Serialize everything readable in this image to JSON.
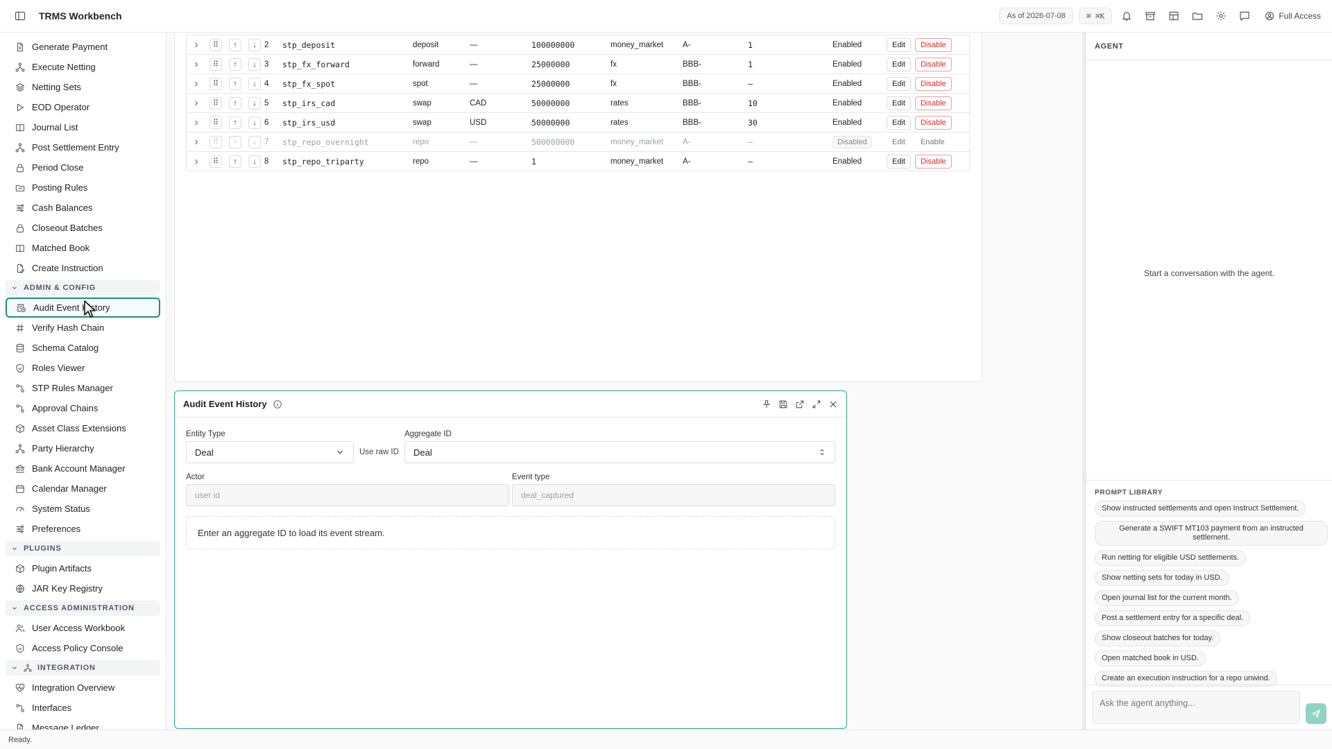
{
  "app": {
    "title": "TRMS Workbench",
    "as_of": "As of 2026-07-08",
    "shortcut": "⌘ ⌘K",
    "access": "Full Access"
  },
  "sidebar": {
    "items_top": [
      {
        "label": "Generate Payment",
        "icon": "doc-icon"
      },
      {
        "label": "Execute Netting",
        "icon": "network-icon"
      },
      {
        "label": "Netting Sets",
        "icon": "layers-icon"
      },
      {
        "label": "EOD Operator",
        "icon": "play-icon"
      },
      {
        "label": "Journal List",
        "icon": "book-icon"
      },
      {
        "label": "Post Settlement Entry",
        "icon": "network-icon"
      },
      {
        "label": "Period Close",
        "icon": "lock-icon"
      },
      {
        "label": "Posting Rules",
        "icon": "folder-icon"
      },
      {
        "label": "Cash Balances",
        "icon": "sliders-icon"
      },
      {
        "label": "Closeout Batches",
        "icon": "lock-icon"
      },
      {
        "label": "Matched Book",
        "icon": "book-icon"
      },
      {
        "label": "Create Instruction",
        "icon": "doc-edit-icon"
      }
    ],
    "section_admin": "ADMIN & CONFIG",
    "items_admin": [
      {
        "label": "Audit Event History",
        "icon": "history-icon"
      },
      {
        "label": "Verify Hash Chain",
        "icon": "hash-icon"
      },
      {
        "label": "Schema Catalog",
        "icon": "database-icon"
      },
      {
        "label": "Roles Viewer",
        "icon": "shield-icon"
      },
      {
        "label": "STP Rules Manager",
        "icon": "flow-icon"
      },
      {
        "label": "Approval Chains",
        "icon": "flow-icon"
      },
      {
        "label": "Asset Class Extensions",
        "icon": "package-icon"
      },
      {
        "label": "Party Hierarchy",
        "icon": "network-icon"
      },
      {
        "label": "Bank Account Manager",
        "icon": "bank-icon"
      },
      {
        "label": "Calendar Manager",
        "icon": "calendar-icon"
      },
      {
        "label": "System Status",
        "icon": "gauge-icon"
      },
      {
        "label": "Preferences",
        "icon": "sliders-icon"
      }
    ],
    "section_plugins": "PLUGINS",
    "items_plugins": [
      {
        "label": "Plugin Artifacts",
        "icon": "package-icon"
      },
      {
        "label": "JAR Key Registry",
        "icon": "globe-icon"
      }
    ],
    "section_access": "ACCESS ADMINISTRATION",
    "items_access": [
      {
        "label": "User Access Workbook",
        "icon": "users-icon"
      },
      {
        "label": "Access Policy Console",
        "icon": "shield-icon"
      }
    ],
    "section_integration": "INTEGRATION",
    "items_integration": [
      {
        "label": "Integration Overview",
        "icon": "heart-icon"
      },
      {
        "label": "Interfaces",
        "icon": "flow-icon"
      },
      {
        "label": "Message Ledger",
        "icon": "doc-icon"
      }
    ]
  },
  "rules": {
    "rows": [
      {
        "num": "2",
        "name": "stp_deposit",
        "type": "deposit",
        "ccy": "—",
        "notional": "100000000",
        "asset_class": "money_market",
        "rating": "A-",
        "days": "1",
        "status": "Enabled",
        "edit": "Edit",
        "toggle": "Disable",
        "disabled": false
      },
      {
        "num": "3",
        "name": "stp_fx_forward",
        "type": "forward",
        "ccy": "—",
        "notional": "25000000",
        "asset_class": "fx",
        "rating": "BBB-",
        "days": "1",
        "status": "Enabled",
        "edit": "Edit",
        "toggle": "Disable",
        "disabled": false
      },
      {
        "num": "4",
        "name": "stp_fx_spot",
        "type": "spot",
        "ccy": "—",
        "notional": "25000000",
        "asset_class": "fx",
        "rating": "BBB-",
        "days": "—",
        "status": "Enabled",
        "edit": "Edit",
        "toggle": "Disable",
        "disabled": false
      },
      {
        "num": "5",
        "name": "stp_irs_cad",
        "type": "swap",
        "ccy": "CAD",
        "notional": "50000000",
        "asset_class": "rates",
        "rating": "BBB-",
        "days": "10",
        "status": "Enabled",
        "edit": "Edit",
        "toggle": "Disable",
        "disabled": false
      },
      {
        "num": "6",
        "name": "stp_irs_usd",
        "type": "swap",
        "ccy": "USD",
        "notional": "50000000",
        "asset_class": "rates",
        "rating": "BBB-",
        "days": "30",
        "status": "Enabled",
        "edit": "Edit",
        "toggle": "Disable",
        "disabled": false
      },
      {
        "num": "7",
        "name": "stp_repo_overnight",
        "type": "repo",
        "ccy": "—",
        "notional": "500000000",
        "asset_class": "money_market",
        "rating": "A-",
        "days": "—",
        "status": "Disabled",
        "edit": "Edit",
        "toggle": "Enable",
        "disabled": true
      },
      {
        "num": "8",
        "name": "stp_repo_triparty",
        "type": "repo",
        "ccy": "—",
        "notional": "1",
        "asset_class": "money_market",
        "rating": "A-",
        "days": "—",
        "status": "Enabled",
        "edit": "Edit",
        "toggle": "Disable",
        "disabled": false
      }
    ]
  },
  "audit": {
    "title": "Audit Event History",
    "entity_type_label": "Entity Type",
    "entity_type_value": "Deal",
    "use_raw_id": "Use raw ID",
    "aggregate_id_label": "Aggregate ID",
    "aggregate_id_value": "Deal",
    "actor_label": "Actor",
    "actor_placeholder": "user id",
    "event_type_label": "Event type",
    "event_type_placeholder": "deal_captured",
    "empty_message": "Enter an aggregate ID to load its event stream."
  },
  "agent": {
    "title": "AGENT",
    "empty": "Start a conversation with the agent.",
    "prompt_library_title": "PROMPT LIBRARY",
    "prompts": [
      "Show instructed settlements and open Instruct Settlement.",
      "Generate a SWIFT MT103 payment from an instructed settlement.",
      "Run netting for eligible USD settlements.",
      "Show netting sets for today in USD.",
      "Open journal list for the current month.",
      "Post a settlement entry for a specific deal.",
      "Show closeout batches for today.",
      "Open matched book in USD.",
      "Create an execution instruction for a repo unwind."
    ],
    "input_placeholder": "Ask the agent anything..."
  },
  "status": {
    "text": "Ready."
  },
  "colors": {
    "accent": "#1f8a7f",
    "danger": "#dc2626",
    "send": "#8fd3c4"
  }
}
